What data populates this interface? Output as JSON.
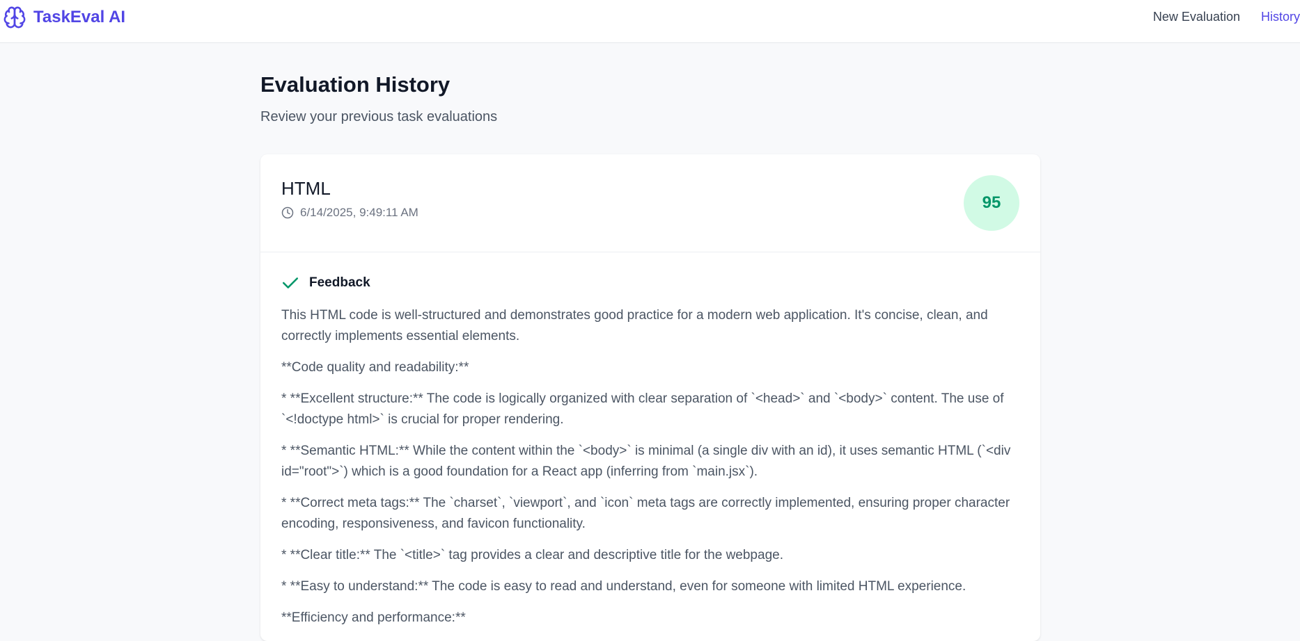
{
  "app": {
    "brand": "TaskEval AI",
    "brand_icon": "brain-icon",
    "accent_color": "#5145e5"
  },
  "nav": {
    "new_evaluation": "New Evaluation",
    "history": "History",
    "active": "History"
  },
  "page": {
    "title": "Evaluation History",
    "subtitle": "Review your previous task evaluations"
  },
  "evaluation": {
    "task": "HTML",
    "timestamp": "6/14/2025, 9:49:11 AM",
    "score": "95",
    "score_color": "#059669",
    "feedback_heading": "Feedback",
    "feedback_paragraphs": [
      "This HTML code is well-structured and demonstrates good practice for a modern web application. It's concise, clean, and correctly implements essential elements.",
      "**Code quality and readability:**",
      "* **Excellent structure:** The code is logically organized with clear separation of `<head>` and `<body>` content. The use of `<!doctype html>` is crucial for proper rendering.",
      "* **Semantic HTML:** While the content within the `<body>` is minimal (a single div with an id), it uses semantic HTML (`<div id=\"root\">`) which is a good foundation for a React app (inferring from `main.jsx`).",
      "* **Correct meta tags:** The `charset`, `viewport`, and `icon` meta tags are correctly implemented, ensuring proper character encoding, responsiveness, and favicon functionality.",
      "* **Clear title:** The `<title>` tag provides a clear and descriptive title for the webpage.",
      "* **Easy to understand:** The code is easy to read and understand, even for someone with limited HTML experience.",
      "**Efficiency and performance:**"
    ]
  }
}
